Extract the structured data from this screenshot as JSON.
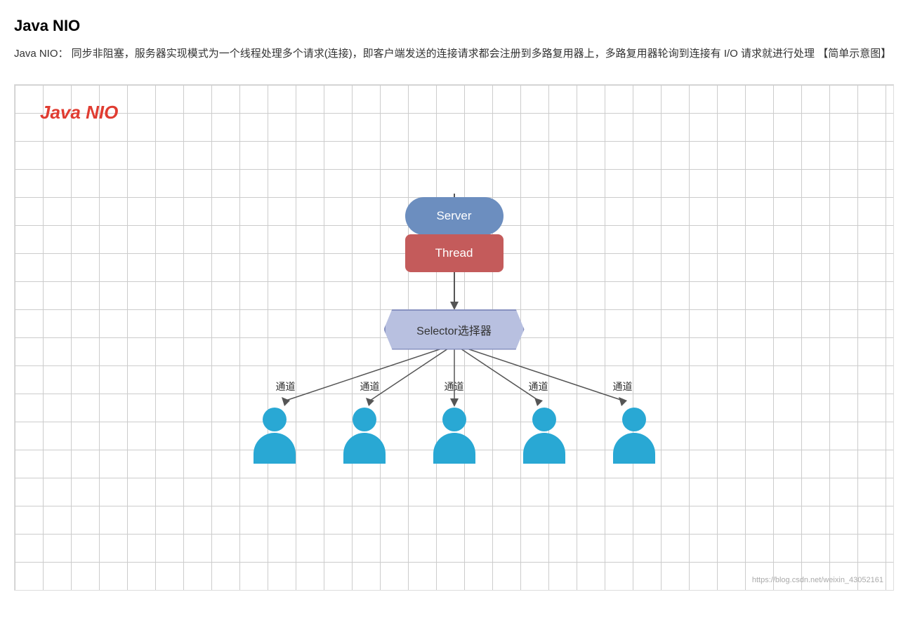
{
  "page": {
    "title": "Java NIO",
    "description": "Java NIO： 同步非阻塞，服务器实现模式为一个线程处理多个请求(连接)，即客户端发送的连接请求都会注册到多路复用器上，多路复用器轮询到连接有 I/O 请求就进行处理 【简单示意图】",
    "diagram_title": "Java NIO",
    "nodes": {
      "server": "Server",
      "thread": "Thread",
      "selector": "Selector选择器"
    },
    "channel_labels": [
      "通道",
      "通道",
      "通道",
      "通道",
      "通道"
    ],
    "client_count": 5,
    "watermark": "https://blog.csdn.net/weixin_43052161"
  }
}
